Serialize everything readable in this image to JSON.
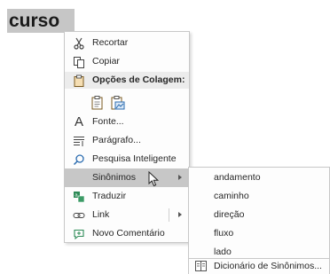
{
  "selected_word": "curso",
  "context_menu": {
    "items": [
      {
        "label": "Recortar",
        "icon": "scissors-icon"
      },
      {
        "label": "Copiar",
        "icon": "copy-icon"
      },
      {
        "label": "Opções de Colagem:",
        "icon": "clipboard-icon"
      },
      {
        "label": "Fonte...",
        "icon": "font-icon"
      },
      {
        "label": "Parágrafo...",
        "icon": "paragraph-icon"
      },
      {
        "label": "Pesquisa Inteligente",
        "icon": "smart-lookup-icon"
      },
      {
        "label": "Sinônimos",
        "icon": "none",
        "has_submenu": true,
        "highlighted": true
      },
      {
        "label": "Traduzir",
        "icon": "translate-icon"
      },
      {
        "label": "Link",
        "icon": "link-icon",
        "has_submenu": true
      },
      {
        "label": "Novo Comentário",
        "icon": "comment-icon"
      }
    ],
    "paste_options": [
      "paste-keep-formatting-icon",
      "paste-picture-icon"
    ]
  },
  "synonyms_submenu": {
    "items": [
      "andamento",
      "caminho",
      "direção",
      "fluxo",
      "lado"
    ],
    "dictionary_label": "Dicionário de Sinônimos..."
  },
  "colors": {
    "highlight": "#c7c7c7",
    "selection": "#c6c6c6",
    "header": "#ececec"
  }
}
